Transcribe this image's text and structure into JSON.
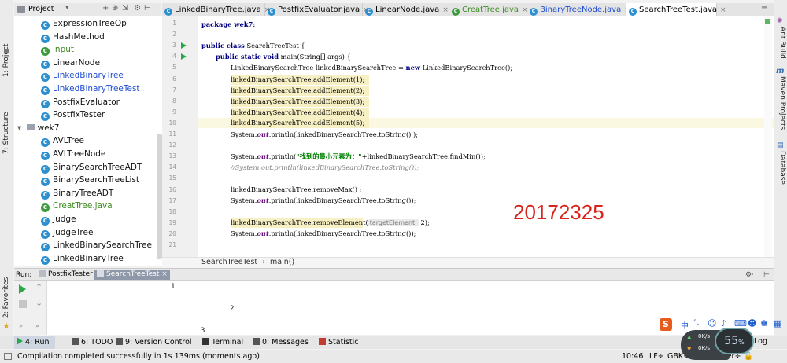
{
  "project_panel": {
    "title": "Project",
    "tree": [
      {
        "label": "ExpressionTreeOp",
        "color": "normal",
        "indent": 1
      },
      {
        "label": "HashMethod",
        "color": "normal",
        "indent": 1
      },
      {
        "label": "input",
        "color": "green",
        "indent": 1
      },
      {
        "label": "LinearNode",
        "color": "normal",
        "indent": 1
      },
      {
        "label": "LinkedBinaryTree",
        "color": "blue",
        "indent": 1
      },
      {
        "label": "LinkedBinaryTreeTest",
        "color": "blue",
        "indent": 1
      },
      {
        "label": "PostfixEvaluator",
        "color": "normal",
        "indent": 1
      },
      {
        "label": "PostfixTester",
        "color": "normal",
        "indent": 1
      },
      {
        "label": "wek7",
        "color": "normal",
        "indent": 0,
        "folder": true
      },
      {
        "label": "AVLTree",
        "color": "normal",
        "indent": 1
      },
      {
        "label": "AVLTreeNode",
        "color": "normal",
        "indent": 1
      },
      {
        "label": "BinarySearchTreeADT",
        "color": "normal",
        "indent": 1
      },
      {
        "label": "BinarySearchTreeList",
        "color": "normal",
        "indent": 1
      },
      {
        "label": "BinaryTreeADT",
        "color": "normal",
        "indent": 1
      },
      {
        "label": "CreatTree.java",
        "color": "green",
        "indent": 1
      },
      {
        "label": "Judge",
        "color": "normal",
        "indent": 1
      },
      {
        "label": "JudgeTree",
        "color": "normal",
        "indent": 1
      },
      {
        "label": "LinkedBinarySearchTree",
        "color": "normal",
        "indent": 1
      },
      {
        "label": "LinkedBinaryTree",
        "color": "normal",
        "indent": 1
      }
    ]
  },
  "editor_tabs": [
    {
      "label": "LinkedBinaryTree.java",
      "active": false
    },
    {
      "label": "PostfixEvaluator.java",
      "active": false
    },
    {
      "label": "LinearNode.java",
      "active": false
    },
    {
      "label": "CreatTree.java",
      "active": false,
      "green": true
    },
    {
      "label": "BinaryTreeNode.java",
      "active": false,
      "blue": true
    },
    {
      "label": "SearchTreeTest.java",
      "active": true
    }
  ],
  "line_numbers": [
    "1",
    "2",
    "3",
    "4",
    "5",
    "6",
    "7",
    "8",
    "9",
    "10",
    "11",
    "12",
    "13",
    "14",
    "15",
    "16",
    "17",
    "18",
    "19",
    "20",
    "21"
  ],
  "code": {
    "l1": "package wek7;",
    "l3a": "public class",
    "l3b": " SearchTreeTest {",
    "l4a": "public static void",
    "l4b": " main(String[] args) {",
    "l5a": "LinkedBinarySearchTree linkedBinarySearchTree = ",
    "l5b": "new",
    "l5c": " LinkedBinarySearchTree();",
    "l6": "linkedBinarySearchTree.addElement(1);",
    "l7": "linkedBinarySearchTree.addElement(2);",
    "l8": "linkedBinarySearchTree.addElement(3);",
    "l9": "linkedBinarySearchTree.addElement(4);",
    "l10": "linkedBinarySearchTree.addElement(5);",
    "l11a": "System.",
    "l11b": "out",
    "l11c": ".println(linkedBinarySearchTree.toString() );",
    "l13a": "System.",
    "l13b": "out",
    "l13c": ".println(",
    "l13d": "\"找到的最小元素为：\"",
    "l13e": "+linkedBinarySearchTree.findMin());",
    "l14": "//System.out.println(linkedBinarySearchTree.toString());",
    "l16": "linkedBinarySearchTree.removeMax() ;",
    "l17a": "System.",
    "l17b": "out",
    "l17c": ".println(linkedBinarySearchTree.toString());",
    "l19a": "linkedBinarySearchTree.removeElement(",
    "l19hint": "targetElement:",
    "l19b": " 2);",
    "l20a": "System.",
    "l20b": "out",
    "l20c": ".println(linkedBinarySearchTree.toString());"
  },
  "overlay_number": "20172325",
  "breadcrumb": {
    "class": "SearchTreeTest",
    "sep": "›",
    "method": "main()"
  },
  "run_panel": {
    "label": "Run:",
    "tabs": [
      {
        "label": "PostfixTester",
        "active": false
      },
      {
        "label": "SearchTreeTest",
        "active": true
      }
    ],
    "output": [
      "1",
      "2",
      "3"
    ]
  },
  "left_strip": {
    "project": "1: Project",
    "structure": "7: Structure",
    "favorites": "2: Favorites"
  },
  "right_strip": {
    "ant": "Ant Build",
    "maven": "Maven Projects",
    "database": "Database"
  },
  "bottom_tabs": [
    {
      "label": "4: Run",
      "active": true
    },
    {
      "label": "6: TODO",
      "active": false
    },
    {
      "label": "9: Version Control",
      "active": false
    },
    {
      "label": "Terminal",
      "active": false
    },
    {
      "label": "0: Messages",
      "active": false
    },
    {
      "label": "Statistic",
      "active": false
    }
  ],
  "bottom_right": {
    "log": "Log"
  },
  "status": {
    "message": "Compilation completed successfully in 1s 139ms (moments ago)",
    "position": "10:46",
    "line_sep": "LF÷",
    "encoding": "GBK÷",
    "git": "Git: master÷"
  },
  "ime": {
    "label": "中",
    "punct": "°,"
  },
  "net_widget": {
    "up": "0K/s",
    "down": "0K/s",
    "gauge": "55",
    "unit": "%"
  },
  "colors": {
    "accent_run": "#2aa845",
    "overlay_red": "#d9241c",
    "class_icon": "#2c8fcf"
  }
}
